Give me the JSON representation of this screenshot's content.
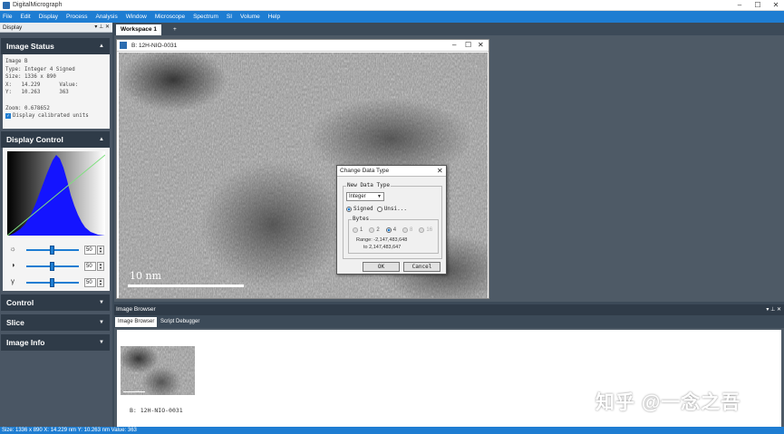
{
  "window": {
    "title": "DigitalMicrograph",
    "min": "–",
    "max": "☐",
    "close": "✕"
  },
  "menu": [
    "File",
    "Edit",
    "Display",
    "Process",
    "Analysis",
    "Window",
    "Microscope",
    "Spectrum",
    "SI",
    "Volume",
    "Help"
  ],
  "left_panel": {
    "header": "Display",
    "header_controls": "▾ ⊥ ✕",
    "image_status": {
      "title": "Image Status",
      "lines": [
        "Image B",
        "Type: Integer 4 Signed",
        "Size: 1336 x 890",
        "X:   14.229      Value:",
        "Y:   10.263      363",
        "",
        "Zoom: 0.678652"
      ],
      "checkbox_label": "Display calibrated units"
    },
    "display_control": {
      "title": "Display Control",
      "sliders": [
        {
          "icon": "☼",
          "value": "50"
        },
        {
          "icon": "◑",
          "value": "50"
        },
        {
          "icon": "γ",
          "value": "50"
        }
      ]
    },
    "sections": [
      "Control",
      "Slice",
      "Image Info"
    ]
  },
  "workspace": {
    "tab": "Workspace 1",
    "add": "+"
  },
  "image_window": {
    "title": "B: 12H-NIO-0031",
    "scalebar": "10 nm"
  },
  "dialog": {
    "title": "Change Data Type",
    "group_label": "New Data Type",
    "select_value": "Integer",
    "signed_label": "Signed",
    "unsigned_label": "Unsi...",
    "bytes_label": "Bytes",
    "bytes": [
      "1",
      "2",
      "4",
      "8",
      "16"
    ],
    "range_line1": "Range: -2,147,483,648",
    "range_line2": "to  2,147,483,647",
    "ok": "OK",
    "cancel": "Cancel"
  },
  "image_browser": {
    "title": "Image Browser",
    "controls": "▾ ⊥ ✕",
    "tabs": [
      "Image Browser",
      "Script Debugger"
    ],
    "thumb_label": "B: 12H-NIO-0031"
  },
  "status_bar": "Size: 1336 x 890   X: 14.229 nm   Y: 10.263 nm   Value: 363",
  "watermark": "知乎 @一念之吾"
}
